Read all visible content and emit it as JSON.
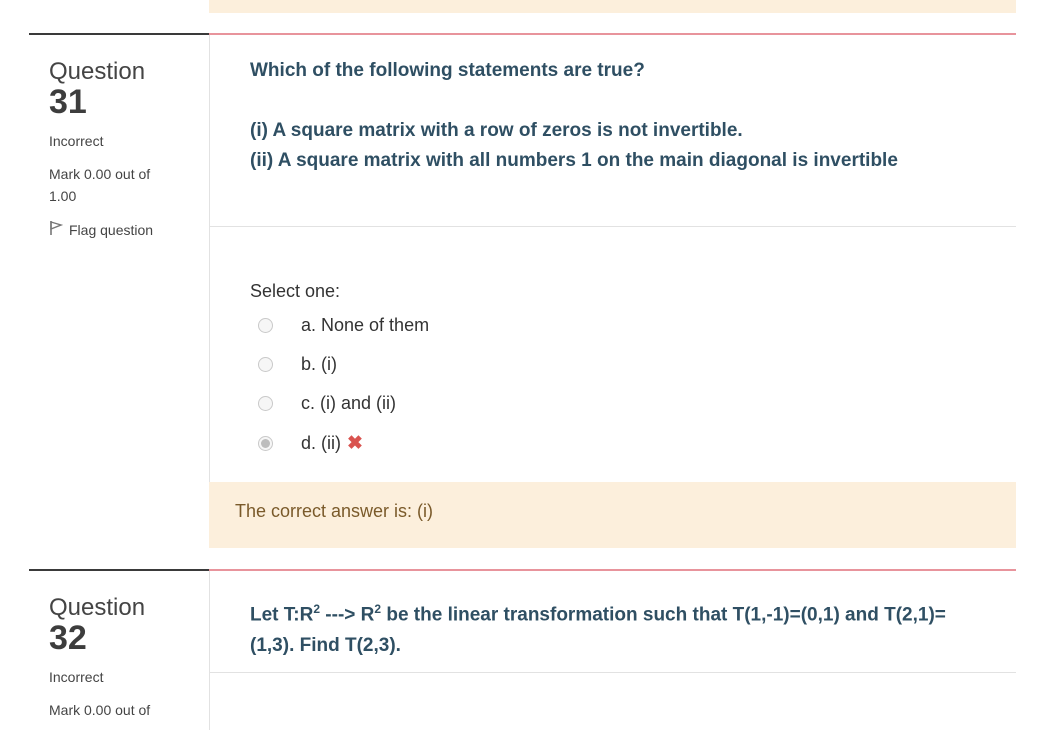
{
  "colors": {
    "rule_dark": "#3a3a3a",
    "rule_pink": "#e8949c",
    "feedback_bg": "#fcefdc",
    "question_text": "#2f4f63",
    "incorrect_mark": "#d9534f"
  },
  "q31": {
    "label": "Question",
    "number": "31",
    "state": "Incorrect",
    "mark_line1": "Mark 0.00 out of",
    "mark_line2": "1.00",
    "flag_label": "Flag question",
    "text": "Which of the following statements are true?",
    "statement_1": "(i) A square matrix with a row of zeros is not invertible.",
    "statement_2": "(ii) A square matrix with all numbers 1 on the main diagonal is invertible",
    "prompt": "Select one:",
    "options": [
      {
        "label": "a. None of them",
        "selected": false
      },
      {
        "label": "b. (i)",
        "selected": false
      },
      {
        "label": "c. (i) and (ii)",
        "selected": false
      },
      {
        "label": "d. (ii)",
        "selected": true
      }
    ],
    "incorrect_icon": "cross-icon",
    "feedback": "The correct answer is: (i)"
  },
  "q32": {
    "label": "Question",
    "number": "32",
    "state": "Incorrect",
    "mark_line1": "Mark 0.00 out of",
    "text_a": "Let T:R",
    "sup_a": "2",
    "text_b": " ---> R",
    "sup_b": "2",
    "text_c": " be the linear transformation such that T(1,-1)=(0,1) and T(2,1)=",
    "text_line2": "(1,3). Find T(2,3)."
  }
}
